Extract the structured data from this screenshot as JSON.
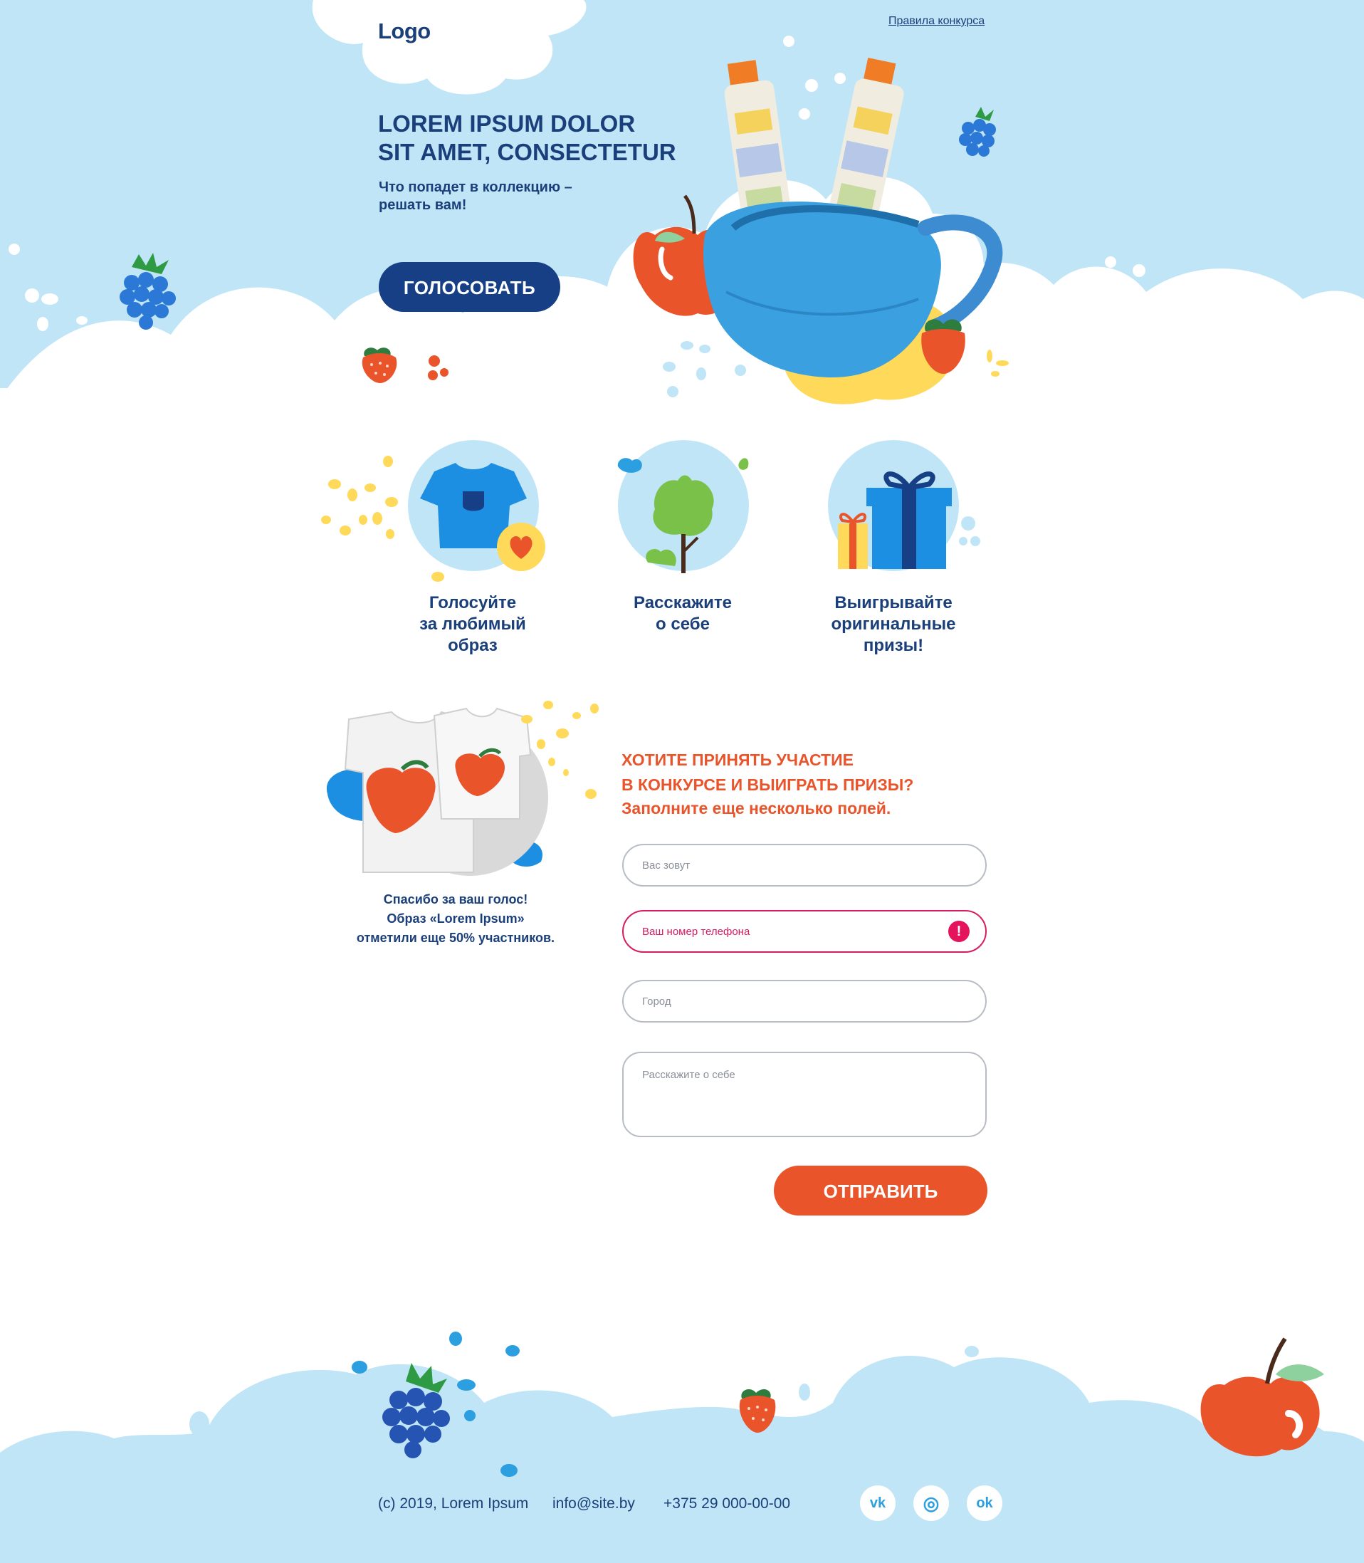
{
  "header": {
    "logo": "Logo",
    "rules_link": "Правила конкурса"
  },
  "hero": {
    "title_line1": "LOREM IPSUM DOLOR",
    "title_line2": "SIT AMET, CONSECTETUR",
    "subtitle_line1": "Что попадет в коллекцию –",
    "subtitle_line2": "решать вам!",
    "vote_button": "ГОЛОСОВАТЬ"
  },
  "features": [
    {
      "line1": "Голосуйте",
      "line2": "за любимый",
      "line3": "образ",
      "icon": "tshirt-heart-icon"
    },
    {
      "line1": "Расскажите",
      "line2": "о себе",
      "icon": "tree-icon"
    },
    {
      "line1": "Выигрывайте",
      "line2": "оригинальные",
      "line3": "призы!",
      "icon": "gift-icon"
    }
  ],
  "thanks": {
    "line1": "Спасибо за ваш голос!",
    "line2": "Образ «Lorem Ipsum»",
    "line3": "отметили еще 50% участников."
  },
  "form": {
    "title_line1": "ХОТИТЕ ПРИНЯТЬ УЧАСТИЕ",
    "title_line2": "В КОНКУРСЕ И ВЫИГРАТЬ ПРИЗЫ?",
    "title_line3": "Заполните еще несколько полей.",
    "name_placeholder": "Вас зовут",
    "phone_placeholder": "Ваш номер телефона",
    "city_placeholder": "Город",
    "about_placeholder": "Расскажите о себе",
    "error_mark": "!",
    "submit_button": "ОТПРАВИТЬ"
  },
  "footer": {
    "copyright": "(c) 2019, Lorem Ipsum",
    "email": "info@site.by",
    "phone": "+375 29 000-00-00",
    "social": [
      {
        "name": "vk-icon",
        "glyph": "vk"
      },
      {
        "name": "instagram-icon",
        "glyph": "◎"
      },
      {
        "name": "odnoklassniki-icon",
        "glyph": "ok"
      }
    ]
  },
  "colors": {
    "navy": "#1b3f7a",
    "button_navy": "#163f85",
    "orange": "#e9542b",
    "sky": "#bfe5f7",
    "error": "#d81b60"
  }
}
